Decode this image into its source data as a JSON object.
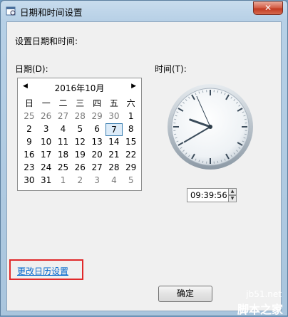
{
  "window": {
    "title": "日期和时间设置",
    "close_glyph": "✕"
  },
  "heading": "设置日期和时间:",
  "date_label": "日期(D):",
  "time_label": "时间(T):",
  "calendar": {
    "month_label": "2016年10月",
    "prev_glyph": "◀",
    "next_glyph": "▶",
    "weekdays": [
      "日",
      "一",
      "二",
      "三",
      "四",
      "五",
      "六"
    ],
    "weeks": [
      [
        {
          "d": "25",
          "o": true
        },
        {
          "d": "26",
          "o": true
        },
        {
          "d": "27",
          "o": true
        },
        {
          "d": "28",
          "o": true
        },
        {
          "d": "29",
          "o": true
        },
        {
          "d": "30",
          "o": true
        },
        {
          "d": "1",
          "o": false
        }
      ],
      [
        {
          "d": "2",
          "o": false
        },
        {
          "d": "3",
          "o": false
        },
        {
          "d": "4",
          "o": false
        },
        {
          "d": "5",
          "o": false
        },
        {
          "d": "6",
          "o": false
        },
        {
          "d": "7",
          "o": false,
          "sel": true
        },
        {
          "d": "8",
          "o": false
        }
      ],
      [
        {
          "d": "9",
          "o": false
        },
        {
          "d": "10",
          "o": false
        },
        {
          "d": "11",
          "o": false
        },
        {
          "d": "12",
          "o": false
        },
        {
          "d": "13",
          "o": false
        },
        {
          "d": "14",
          "o": false
        },
        {
          "d": "15",
          "o": false
        }
      ],
      [
        {
          "d": "16",
          "o": false
        },
        {
          "d": "17",
          "o": false
        },
        {
          "d": "18",
          "o": false
        },
        {
          "d": "19",
          "o": false
        },
        {
          "d": "20",
          "o": false
        },
        {
          "d": "21",
          "o": false
        },
        {
          "d": "22",
          "o": false
        }
      ],
      [
        {
          "d": "23",
          "o": false
        },
        {
          "d": "24",
          "o": false
        },
        {
          "d": "25",
          "o": false
        },
        {
          "d": "26",
          "o": false
        },
        {
          "d": "27",
          "o": false
        },
        {
          "d": "28",
          "o": false
        },
        {
          "d": "29",
          "o": false
        }
      ],
      [
        {
          "d": "30",
          "o": false
        },
        {
          "d": "31",
          "o": false
        },
        {
          "d": "1",
          "o": true
        },
        {
          "d": "2",
          "o": true
        },
        {
          "d": "3",
          "o": true
        },
        {
          "d": "4",
          "o": true
        },
        {
          "d": "5",
          "o": true
        }
      ]
    ]
  },
  "clock": {
    "hour": 9,
    "minute": 39,
    "second": 56
  },
  "time_value": "09:39:56",
  "change_calendar_link": "更改日历设置",
  "ok_button": "确定",
  "watermark": {
    "line1": "jb51.net",
    "line2": "脚本之家"
  },
  "colors": {
    "highlight_box": "#e0292a",
    "link": "#0066cc",
    "selected_day_border": "#3c7fb1"
  }
}
